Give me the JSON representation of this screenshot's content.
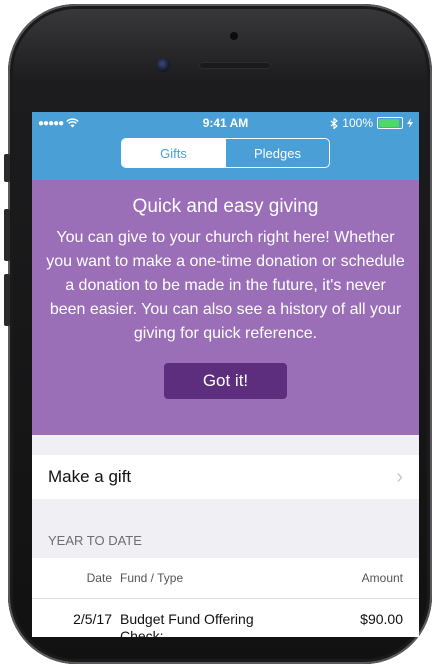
{
  "status_bar": {
    "time": "9:41 AM",
    "battery_text": "100%"
  },
  "tabs": [
    {
      "label": "Gifts",
      "active": true
    },
    {
      "label": "Pledges",
      "active": false
    }
  ],
  "banner": {
    "title": "Quick and easy giving",
    "body": "You can give to your church right here! Whether you want to make a one-time donation or schedule a donation to be made in the future, it's never been easier. You can also see a history of all your giving for quick reference.",
    "button_label": "Got it!",
    "background": "#9b6fb7",
    "button_color": "#5d2e7e"
  },
  "make_gift": {
    "label": "Make a gift"
  },
  "history": {
    "section_title": "YEAR TO DATE",
    "columns": {
      "date": "Date",
      "fund": "Fund / Type",
      "amount": "Amount"
    },
    "rows": [
      {
        "date": "2/5/17",
        "fund": "Budget Fund Offering",
        "type": "Check:",
        "amount": "$90.00"
      }
    ]
  },
  "colors": {
    "accent": "#4a9fd6",
    "battery": "#4cd964"
  }
}
